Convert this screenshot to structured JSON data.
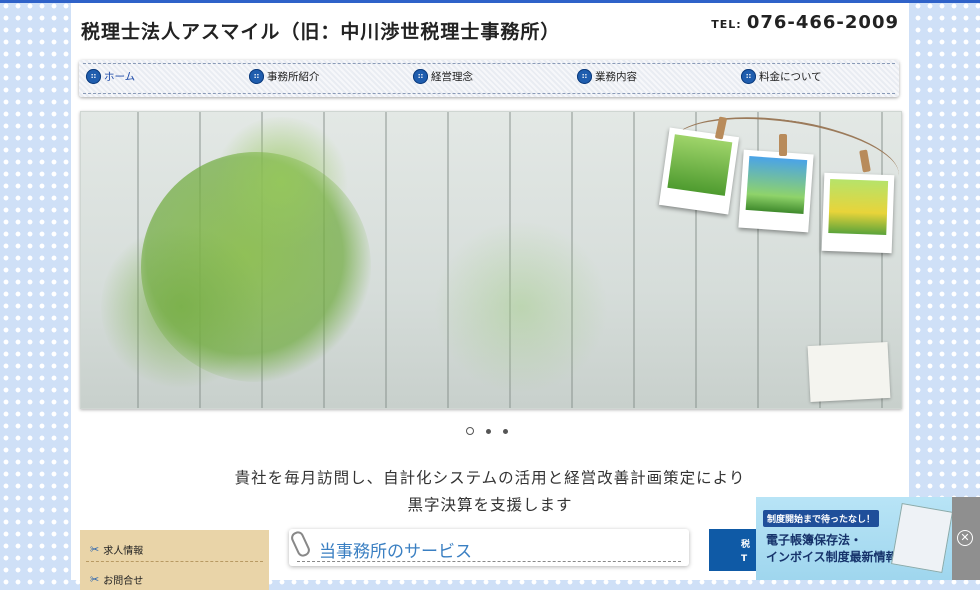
{
  "header": {
    "site_title": "税理士法人アスマイル（旧：中川渉世税理士事務所）",
    "tel_label": "TEL:",
    "tel_number": "076-466-2009"
  },
  "nav": {
    "items": [
      {
        "label": "ホーム",
        "active": true
      },
      {
        "label": "事務所紹介"
      },
      {
        "label": "経営理念"
      },
      {
        "label": "業務内容"
      },
      {
        "label": "料金について"
      }
    ]
  },
  "slider": {
    "count": 3,
    "active_index": 0
  },
  "tagline": {
    "line1": "貴社を毎月訪問し、自計化システムの活用と経営改善計画策定により",
    "line2": "黒字決算を支援します"
  },
  "side_menu": {
    "items": [
      {
        "label": "求人情報"
      },
      {
        "label": "お問合せ"
      }
    ]
  },
  "service": {
    "title": "当事務所のサービス"
  },
  "blue_button": {
    "line1": "税",
    "line2": "T"
  },
  "banner": {
    "tag": "制度開始まで待ったなし！",
    "line1": "電子帳簿保存法・",
    "line2": "インボイス制度最新情報"
  },
  "colors": {
    "accent": "#1f5dae",
    "background": "#cfe0f7",
    "side_menu": "#e9d4a8",
    "service_title": "#3a7fc2"
  }
}
